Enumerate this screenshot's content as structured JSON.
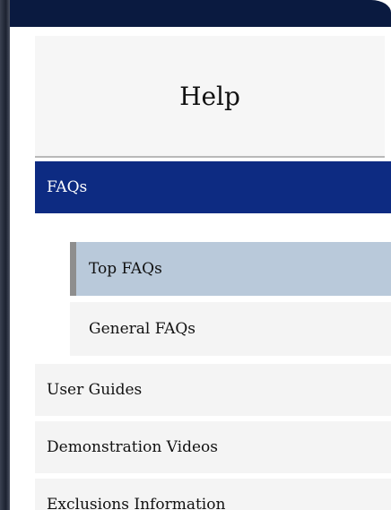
{
  "help": {
    "title": "Help"
  },
  "nav": {
    "active": {
      "label": "FAQs"
    },
    "sub_items": [
      {
        "label": "Top FAQs",
        "selected": true
      },
      {
        "label": "General FAQs",
        "selected": false
      }
    ],
    "items": [
      {
        "label": "User Guides"
      },
      {
        "label": "Demonstration Videos"
      },
      {
        "label": "Exclusions Information"
      }
    ]
  },
  "colors": {
    "active_bg": "#0d2b82",
    "selected_sub_bg": "#b9c9da",
    "selected_sub_accent": "#8e8e8e",
    "item_bg": "#f4f4f4",
    "top_bar": "#0a1a40"
  }
}
